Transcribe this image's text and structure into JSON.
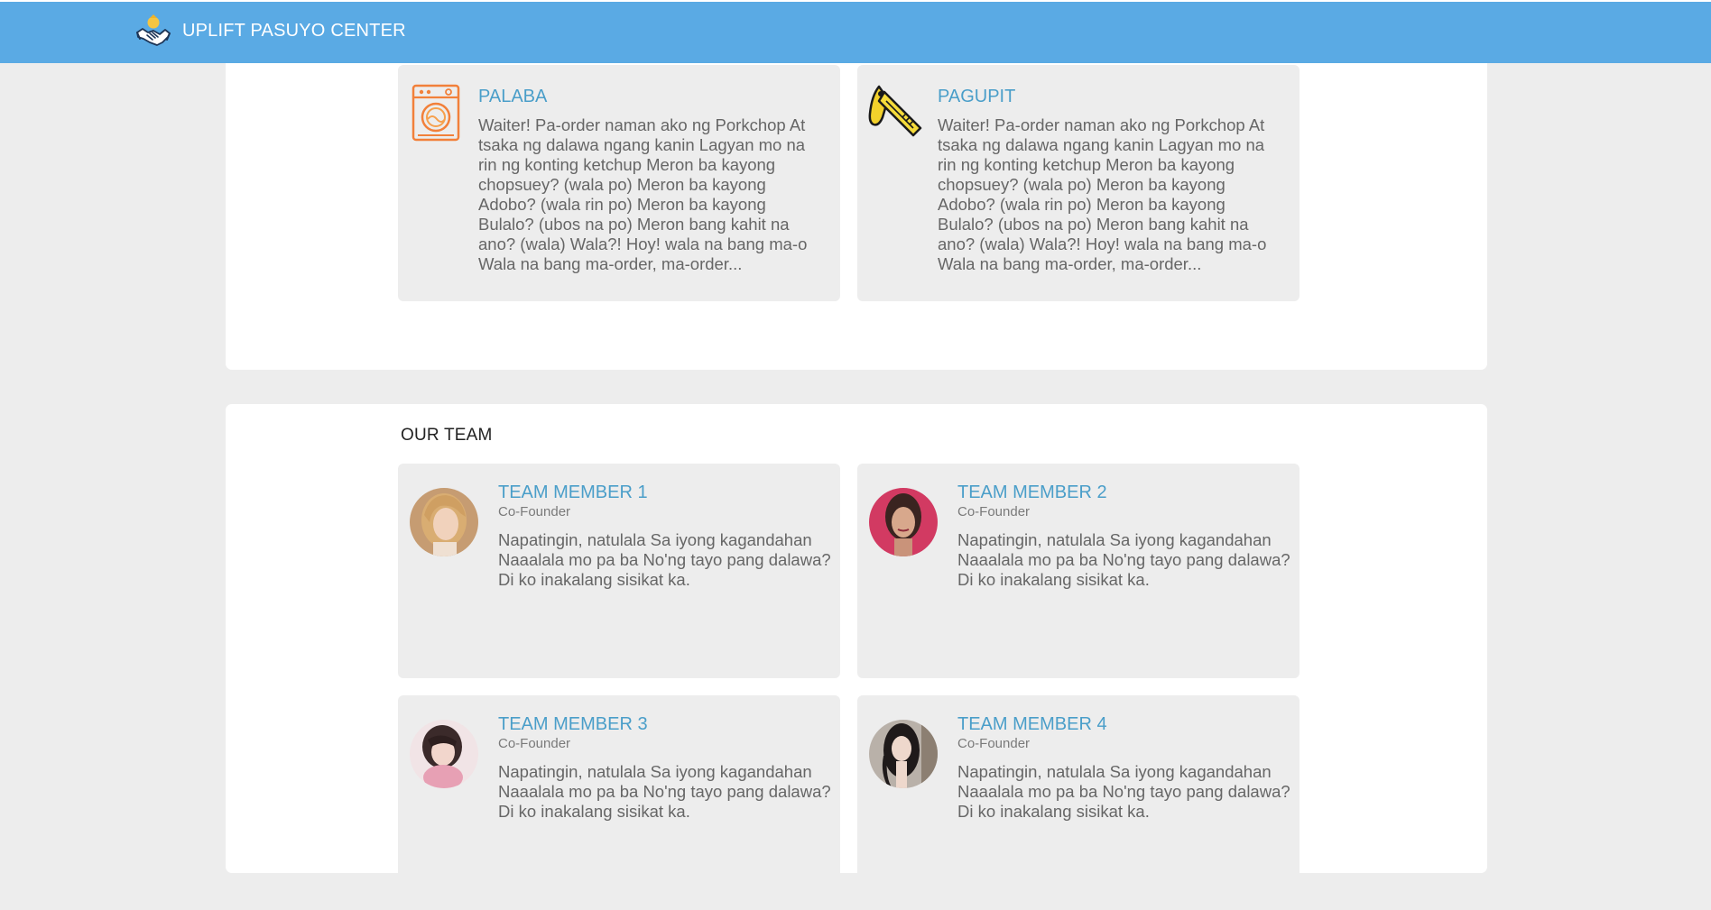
{
  "header": {
    "title": "UPLIFT PASUYO CENTER",
    "logo_icon": "handshake-logo-icon",
    "background": "#5aaae4"
  },
  "services": [
    {
      "title": "PALABA",
      "icon": "washing-machine-icon",
      "text": "Waiter! Pa-order naman ako ng Porkchop At tsaka ng dalawa ngang kanin Lagyan mo na rin ng konting ketchup Meron ba kayong chopsuey? (wala po) Meron ba kayong Adobo? (wala rin po) Meron ba kayong Bulalo? (ubos na po) Meron bang kahit na ano? (wala) Wala?! Hoy! wala na bang ma-o Wala na bang ma-order, ma-order..."
    },
    {
      "title": "PAGUPIT",
      "icon": "razor-icon",
      "text": "Waiter! Pa-order naman ako ng Porkchop At tsaka ng dalawa ngang kanin Lagyan mo na rin ng konting ketchup Meron ba kayong chopsuey? (wala po) Meron ba kayong Adobo? (wala rin po) Meron ba kayong Bulalo? (ubos na po) Meron bang kahit na ano? (wala) Wala?! Hoy! wala na bang ma-o Wala na bang ma-order, ma-order..."
    }
  ],
  "team": {
    "heading": "OUR TEAM",
    "members": [
      {
        "name": "TEAM MEMBER 1",
        "role": "Co-Founder",
        "bio": "Napatingin, natulala Sa iyong kagandahan Naaalala mo pa ba No'ng tayo pang dalawa? Di ko inakalang sisikat ka."
      },
      {
        "name": "TEAM MEMBER 2",
        "role": "Co-Founder",
        "bio": "Napatingin, natulala Sa iyong kagandahan Naaalala mo pa ba No'ng tayo pang dalawa? Di ko inakalang sisikat ka."
      },
      {
        "name": "TEAM MEMBER 3",
        "role": "Co-Founder",
        "bio": "Napatingin, natulala Sa iyong kagandahan Naaalala mo pa ba No'ng tayo pang dalawa? Di ko inakalang sisikat ka."
      },
      {
        "name": "TEAM MEMBER 4",
        "role": "Co-Founder",
        "bio": "Napatingin, natulala Sa iyong kagandahan Naaalala mo pa ba No'ng tayo pang dalawa? Di ko inakalang sisikat ka."
      }
    ]
  },
  "colors": {
    "accent_title": "#4a9ec9",
    "card_bg": "#ededed",
    "page_bg": "#ededed"
  }
}
